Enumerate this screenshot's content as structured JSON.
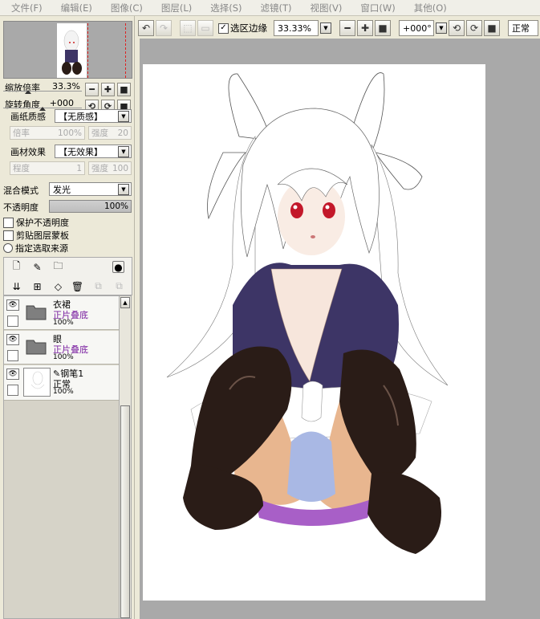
{
  "menu": [
    "文件(F)",
    "编辑(E)",
    "图像(C)",
    "图层(L)",
    "选择(S)",
    "滤镜(T)",
    "视图(V)",
    "窗口(W)",
    "其他(O)"
  ],
  "toolbar": {
    "selection_edge_label": "选区边缘",
    "zoom_value": "33.33%",
    "rotation_value": "+000°",
    "mode_label": "正常"
  },
  "navigator": {
    "zoom_label": "缩放倍率",
    "zoom_value": "33.3%",
    "rotation_label": "旋转角度",
    "rotation_value": "+000"
  },
  "paper": {
    "texture_label": "画纸质感",
    "texture_value": "【无质感】",
    "scale_label": "倍率",
    "scale_value": "100%",
    "strength_label": "强度",
    "strength_value": "20"
  },
  "material": {
    "effect_label": "画材效果",
    "effect_value": "【无效果】",
    "degree_label": "程度",
    "degree_value": "1",
    "strength_label": "强度",
    "strength_value": "100"
  },
  "blend": {
    "mode_label": "混合模式",
    "mode_value": "发光",
    "opacity_label": "不透明度",
    "opacity_value": "100%"
  },
  "options": {
    "protect_opacity": "保护不透明度",
    "clip_layer": "剪贴图层蒙板",
    "selection_source": "指定选取来源"
  },
  "layers": [
    {
      "name": "衣裙",
      "mode": "正片叠底",
      "opacity": "100%"
    },
    {
      "name": "眼",
      "mode": "正片叠底",
      "opacity": "100%"
    },
    {
      "name": "钢笔1",
      "mode": "正常",
      "opacity": "100%"
    }
  ],
  "colors": {
    "accent_purple": "#7a1fa0",
    "canvas_bg": "#a9a9a9",
    "panel_bg": "#ece9d8"
  }
}
